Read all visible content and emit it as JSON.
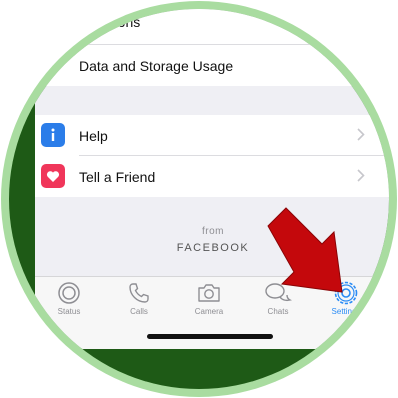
{
  "colors": {
    "ring": "#a9dca0",
    "background_green": "#1e5a16",
    "help_icon": "#2b7de9",
    "tell_friend_icon": "#f0365a",
    "active_tab": "#2b8cf5",
    "arrow": "#c4080c"
  },
  "settings_list": {
    "partial_item_label": "...tions",
    "data_storage_label": "Data and Storage Usage",
    "help_label": "Help",
    "tell_friend_label": "Tell a Friend"
  },
  "footer": {
    "from_label": "from",
    "brand_label": "FACEBOOK"
  },
  "tabbar": {
    "tabs": [
      {
        "label": "Status",
        "icon": "status-icon"
      },
      {
        "label": "Calls",
        "icon": "phone-icon"
      },
      {
        "label": "Camera",
        "icon": "camera-icon"
      },
      {
        "label": "Chats",
        "icon": "chat-bubbles-icon"
      },
      {
        "label": "Settings",
        "icon": "gear-icon",
        "active": true
      }
    ]
  }
}
